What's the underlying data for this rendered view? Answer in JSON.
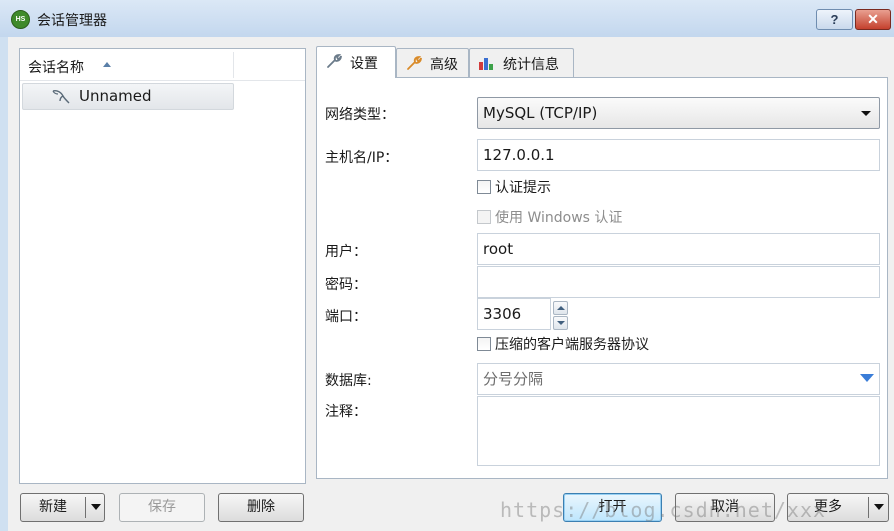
{
  "window": {
    "logo_text": "HS",
    "title": "会话管理器",
    "help_label": "?",
    "close_label": "✕"
  },
  "session_list": {
    "column_header": "会话名称",
    "items": [
      {
        "label": "Unnamed",
        "icon": "mysql-dolphin-icon"
      }
    ]
  },
  "tabs": [
    {
      "label": "设置",
      "icon": "wrench-icon",
      "active": true
    },
    {
      "label": "高级",
      "icon": "wrench-icon",
      "active": false
    },
    {
      "label": "统计信息",
      "icon": "bar-chart-icon",
      "active": false
    }
  ],
  "settings": {
    "network_type": {
      "label": "网络类型：",
      "value": "MySQL (TCP/IP)"
    },
    "host": {
      "label": "主机名/IP：",
      "value": "127.0.0.1"
    },
    "auth_prompt": {
      "label": "认证提示",
      "checked": false
    },
    "windows_auth": {
      "label": "使用 Windows 认证",
      "checked": false,
      "disabled": true
    },
    "user": {
      "label": "用户：",
      "value": "root"
    },
    "password": {
      "label": "密码：",
      "value": ""
    },
    "port": {
      "label": "端口：",
      "value": "3306"
    },
    "compress": {
      "label": "压缩的客户端服务器协议",
      "checked": false
    },
    "database": {
      "label": "数据库:",
      "placeholder": "分号分隔"
    },
    "comment": {
      "label": "注释：",
      "value": ""
    }
  },
  "buttons": {
    "new": "新建",
    "save": "保存",
    "delete": "删除",
    "open": "打开",
    "cancel": "取消",
    "more": "更多"
  },
  "watermark": "https://blog.csdn.net/xxx",
  "colors": {
    "title_bar": "#c3d7ee",
    "accent_blue": "#3a7dd8",
    "close_red": "#c4402d",
    "logo_green": "#3f8a2b"
  }
}
